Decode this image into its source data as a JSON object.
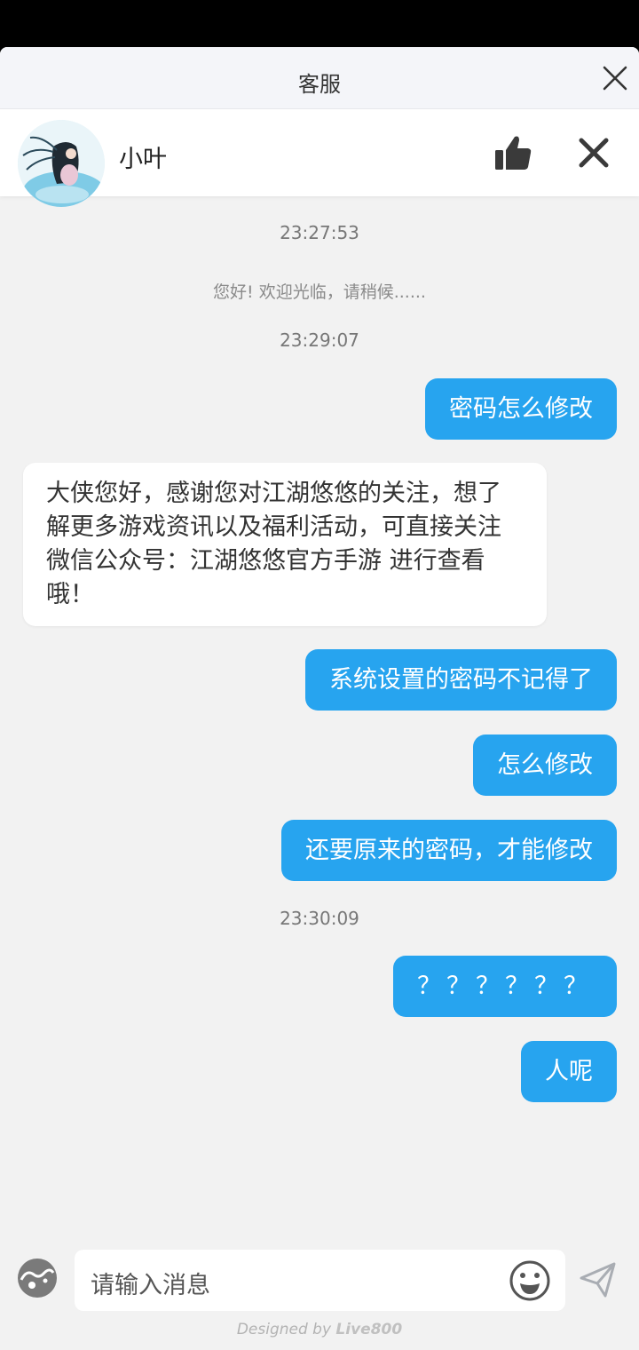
{
  "header": {
    "title": "客服"
  },
  "agent": {
    "name": "小叶"
  },
  "messages": {
    "t1": "23:27:53",
    "welcome": "您好! 欢迎光临，请稍候......",
    "t2": "23:29:07",
    "out1": "密码怎么修改",
    "in1": "大侠您好，感谢您对江湖悠悠的关注，想了解更多游戏资讯以及福利活动，可直接关注微信公众号：江湖悠悠官方手游 进行查看哦！",
    "out2": "系统设置的密码不记得了",
    "out3": "怎么修改",
    "out4": "还要原来的密码，才能修改",
    "t3": "23:30:09",
    "out5": "？？？？？？",
    "out6": "人呢"
  },
  "input": {
    "placeholder": "请输入消息"
  },
  "footer": {
    "prefix": "Designed by",
    "brand": "Live800"
  },
  "colors": {
    "accent": "#27a4ef",
    "background": "#f2f2f2"
  },
  "icons": [
    "close-icon",
    "thumbs-up-icon",
    "theme-icon",
    "emoji-icon",
    "send-icon"
  ]
}
